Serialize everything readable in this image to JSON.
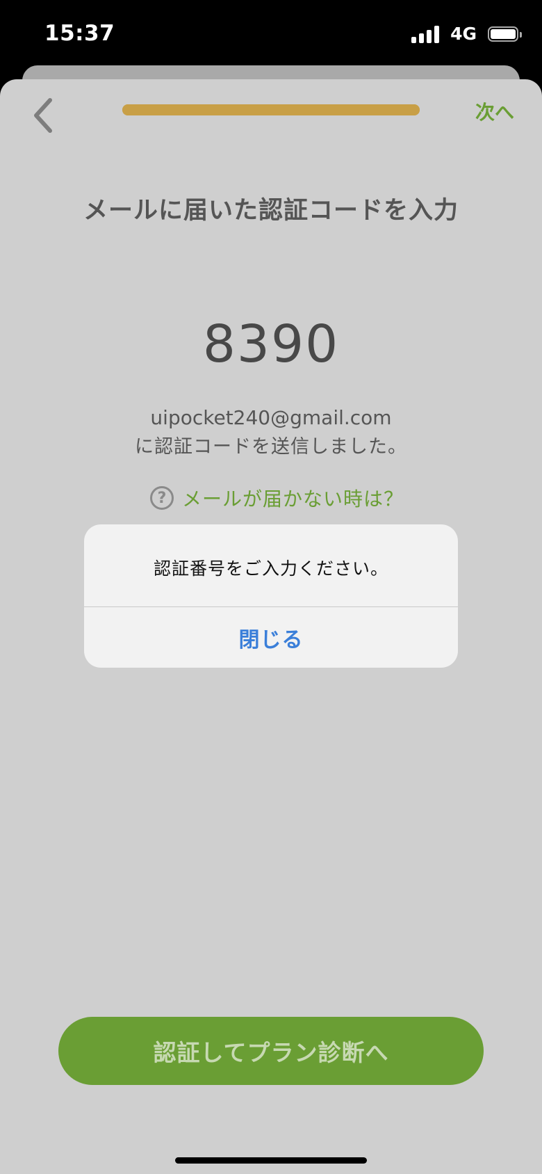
{
  "status_bar": {
    "time": "15:37",
    "network": "4G"
  },
  "nav": {
    "back_icon": "chevron-left-icon",
    "next_label": "次へ",
    "progress": 1.0
  },
  "page": {
    "title": "メールに届いた認証コードを入力",
    "code": "8390",
    "email": "uipocket240@gmail.com",
    "sent_message": "に認証コードを送信しました。",
    "help_icon": "question-circle-icon",
    "help_link": "メールが届かない時は？"
  },
  "primary_button": {
    "label": "認証してプラン診断へ"
  },
  "alert": {
    "message": "認証番号をご入力ください。",
    "close_label": "閉じる"
  },
  "colors": {
    "accent_green": "#6a9e34",
    "progress_gold": "#c89f46",
    "alert_button_blue": "#3b7fd9"
  }
}
